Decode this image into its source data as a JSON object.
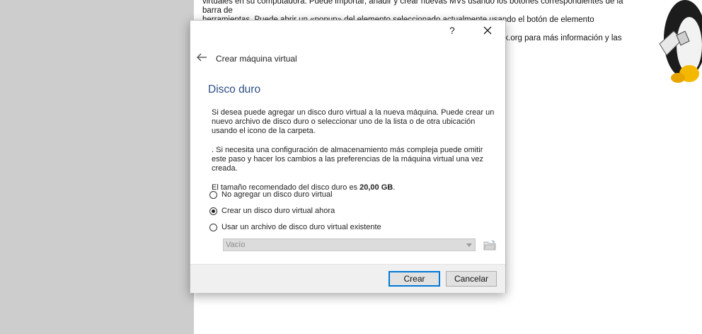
{
  "background": {
    "lines": [
      "virtuales en su computadora. Puede importar, añadir y crear nuevas MVs usando los botones correspondientes de la barra de",
      "herramientas. Puede abrir un «popup» del elemento seleccionado actualmente usando el botón de elemento correspondiente.",
      "Puede presionar la tecla F1 para obtener ayuda instantánea, o visitar www.virtualbox.org para más información y las últimas"
    ]
  },
  "dialog": {
    "help_label": "?",
    "wizard_title": "Crear máquina virtual",
    "page_title": "Disco duro",
    "paragraph1": "Si desea puede agregar un disco duro virtual a la nueva máquina. Puede crear un nuevo archivo de disco duro o seleccionar uno de la lista o de otra ubicación usando el icono de la carpeta.",
    "paragraph2": ". Si necesita una configuración de almacenamiento más compleja puede omitir este paso y hacer los cambios a las preferencias de la máquina virtual una vez creada.",
    "recommended_prefix": "El tamaño recomendado del disco duro es ",
    "recommended_size": "20,00 GB",
    "recommended_suffix": ".",
    "options": [
      {
        "label": "No agregar un disco duro virtual",
        "checked": false
      },
      {
        "label": "Crear un disco duro virtual ahora",
        "checked": true
      },
      {
        "label": "Usar un archivo de disco duro virtual existente",
        "checked": false
      }
    ],
    "existing_disk_value": "Vacío",
    "create_button": "Crear",
    "cancel_button": "Cancelar"
  },
  "icons": {
    "back": "back-arrow-icon",
    "close": "close-icon",
    "folder": "folder-icon",
    "dropdown": "chevron-down-icon",
    "logo": "penguin-logo-icon"
  },
  "colors": {
    "page_title": "#2e4e85",
    "primary_button_border": "#0078d7",
    "left_panel": "#cdcdcd"
  }
}
